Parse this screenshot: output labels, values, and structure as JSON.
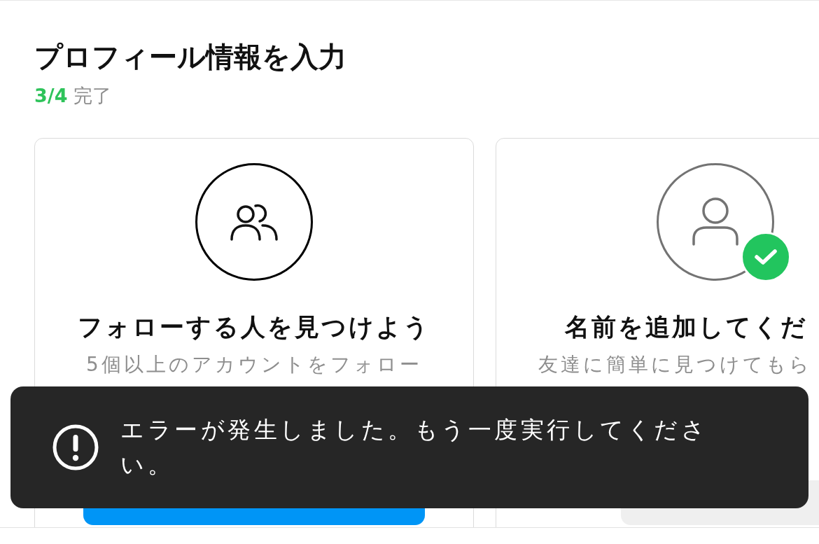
{
  "header": {
    "title": "プロフィール情報を入力",
    "progress": "3/4",
    "progress_label": "完了"
  },
  "cards": [
    {
      "title": "フォローする人を見つけよう",
      "description": "5個以上のアカウントをフォロー",
      "completed": false,
      "button": {
        "kind": "primary"
      }
    },
    {
      "title": "名前を追加してくだ",
      "description": "友達に簡単に見つけてもら",
      "completed": true,
      "button": {
        "kind": "secondary"
      }
    }
  ],
  "toast": {
    "kind": "error",
    "message": "エラーが発生しました。もう一度実行してください。"
  }
}
